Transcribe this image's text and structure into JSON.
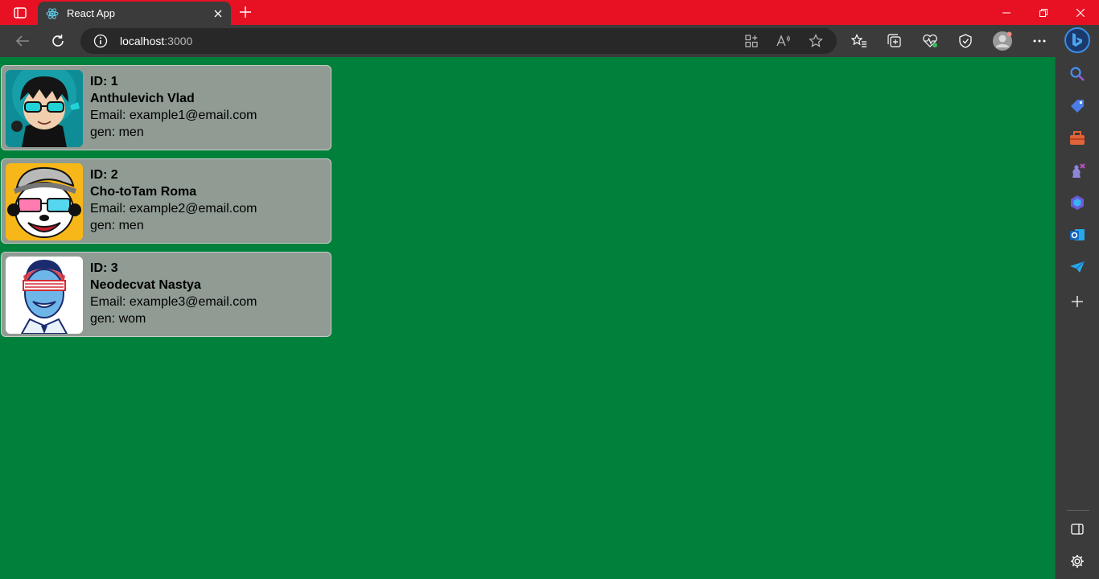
{
  "browser": {
    "tab_title": "React App",
    "url_host": "localhost",
    "url_port": ":3000"
  },
  "users": [
    {
      "id_label": "ID: 1",
      "name": "Anthulevich Vlad",
      "email": "Email: example1@email.com",
      "gen": "gen: men"
    },
    {
      "id_label": "ID: 2",
      "name": "Cho-toTam Roma",
      "email": "Email: example2@email.com",
      "gen": "gen: men"
    },
    {
      "id_label": "ID: 3",
      "name": "Neodecvat Nastya",
      "email": "Email: example3@email.com",
      "gen": "gen: wom"
    }
  ],
  "colors": {
    "titlebar": "#e81123",
    "page_background": "#00813b",
    "card_background": "#8f9b93"
  }
}
